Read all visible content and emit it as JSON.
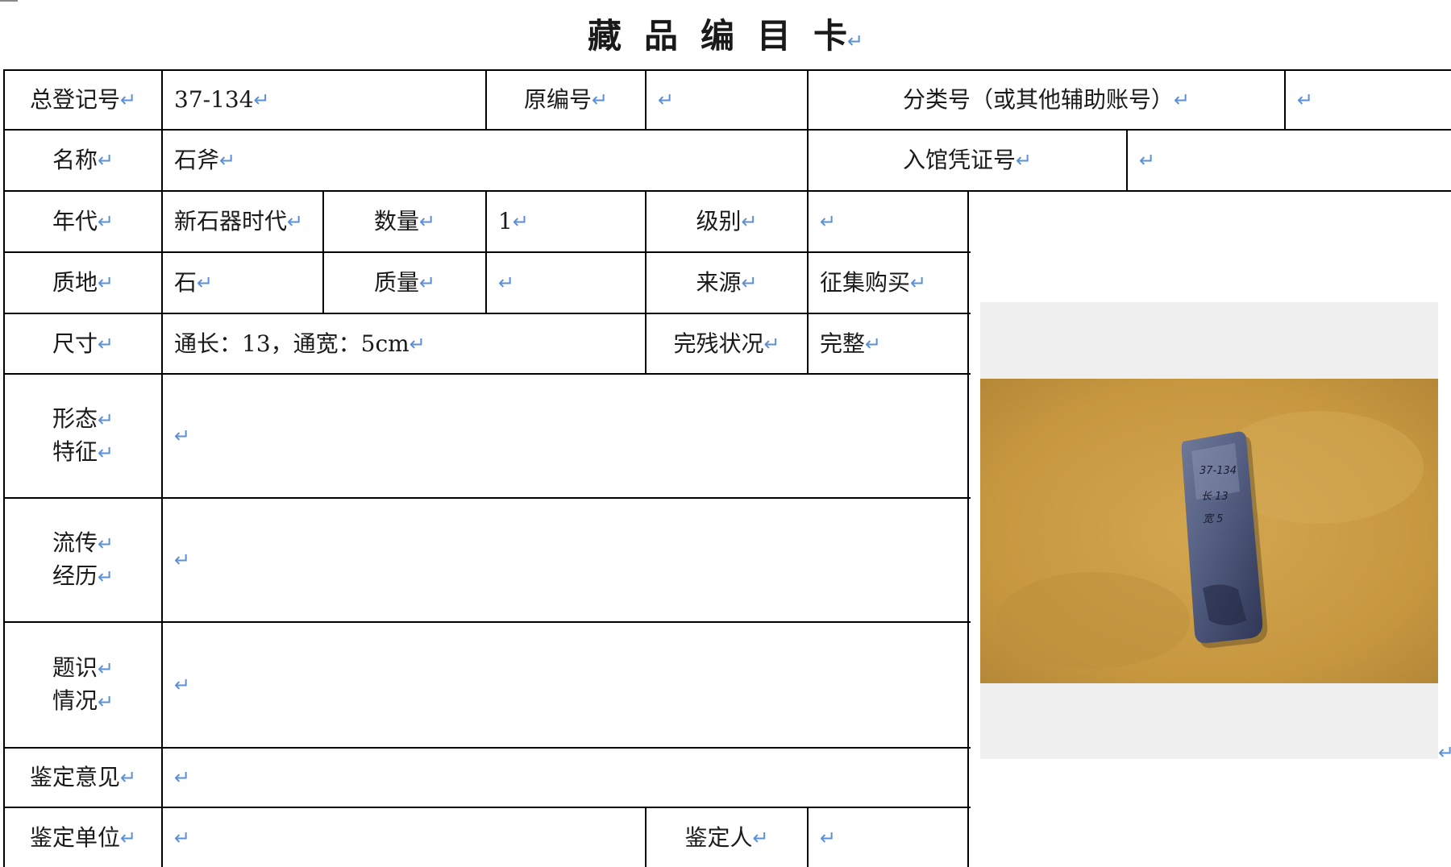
{
  "title": "藏品编目卡",
  "return_mark": "↵",
  "labels": {
    "reg_no": "总登记号",
    "orig_no": "原编号",
    "class_no": "分类号（或其他辅助账号）",
    "name": "名称",
    "voucher": "入馆凭证号",
    "era": "年代",
    "quantity": "数量",
    "level": "级别",
    "material": "质地",
    "weight": "质量",
    "source": "来源",
    "size": "尺寸",
    "condition": "完残状况",
    "form_1": "形态",
    "form_2": "特征",
    "history_1": "流传",
    "history_2": "经历",
    "inscription_1": "题识",
    "inscription_2": "情况",
    "opinion": "鉴定意见",
    "unit": "鉴定单位",
    "appraiser": "鉴定人"
  },
  "values": {
    "reg_no": "37-134",
    "orig_no": "",
    "class_no": "",
    "name": "石斧",
    "voucher": "",
    "era": "新石器时代",
    "quantity": "1",
    "level": "",
    "material": "石",
    "weight": "",
    "source": "征集购买",
    "size": "通长：13，通宽：5cm",
    "condition": "完整",
    "form": "",
    "history": "",
    "inscription": "",
    "opinion": "",
    "unit": "",
    "appraiser": ""
  },
  "photo": {
    "description_icon": "stone-axe-photo",
    "handwriting": [
      "37-134",
      "长 13",
      "宽 5"
    ]
  }
}
